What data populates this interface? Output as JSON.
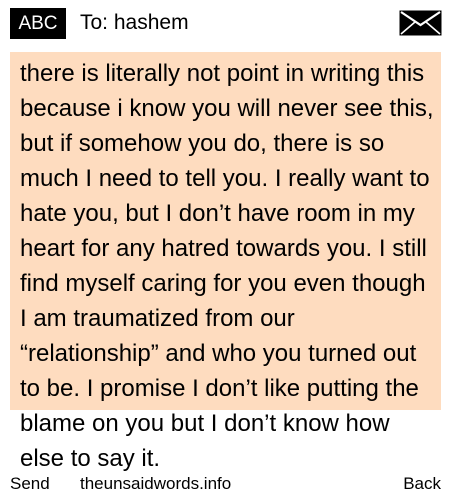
{
  "header": {
    "mode_label": "ABC",
    "recipient": "To: hashem",
    "envelope_icon": "envelope-icon"
  },
  "message": {
    "background_color": "#fedcbf",
    "body": "there is literally not point in writing this because i know you will never see this, but if somehow you do, there is so much I need to tell you. I really want to hate you, but I don’t have room in my heart for any hatred towards you. I still find myself caring for you even though I am traumatized from our “relationship” and who you turned out to be. I promise I don’t like putting the blame on you but I don’t know how else to say it."
  },
  "footer": {
    "left_softkey": "Send",
    "watermark": "theunsaidwords.info",
    "right_softkey": "Back"
  }
}
